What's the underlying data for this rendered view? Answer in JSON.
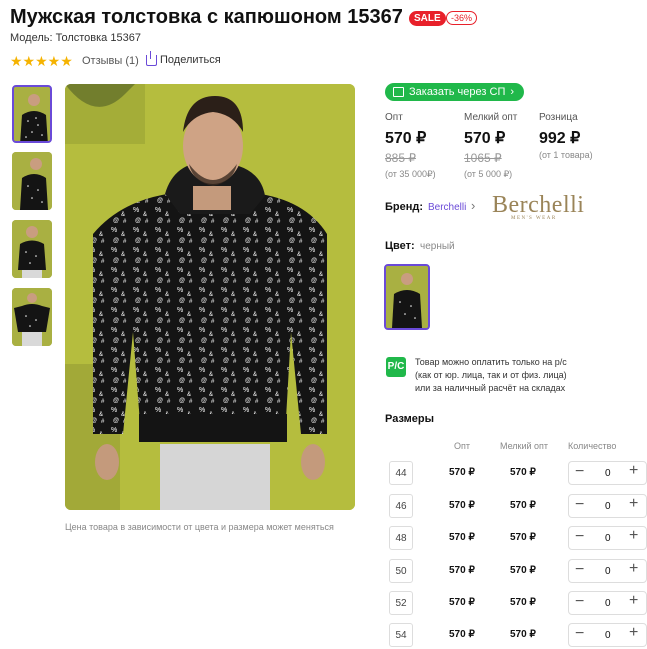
{
  "product": {
    "title": "Мужская толстовка с капюшоном 15367",
    "sale_badge": "SALE",
    "discount_badge": "-36%",
    "model": "Модель: Толстовка 15367",
    "stars": "★★★★★",
    "reviews": "Отзывы (1)",
    "share": "Поделиться"
  },
  "gallery": {
    "caption": "Цена товара в зависимости от цвета и размера может меняться",
    "thumb_count": 4,
    "background_color": "#b8bf3f"
  },
  "order": {
    "button_label": "Заказать через СП",
    "chevron": "›"
  },
  "prices": [
    {
      "label": "Опт",
      "price": "570 ₽",
      "old": "885 ₽",
      "note": "(от 35 000₽)"
    },
    {
      "label": "Мелкий опт",
      "price": "570 ₽",
      "old": "1065 ₽",
      "note": "(от 5 000 ₽)"
    },
    {
      "label": "Розница",
      "price": "992 ₽",
      "old": "",
      "note": "(от 1 товара)"
    }
  ],
  "brand": {
    "label": "Бренд:",
    "name": "Berchelli",
    "chevron": "›",
    "logo_text": "Berchelli",
    "logo_sub": "MEN'S WEAR"
  },
  "color": {
    "label": "Цвет:",
    "value": "черный"
  },
  "payment": {
    "icon_text": "P/C",
    "line1": "Товар можно оплатить только на р/с",
    "line2": "(как от юр. лица, так и от физ. лица)",
    "line3": "или за наличный расчёт на складах"
  },
  "sizes": {
    "title": "Размеры",
    "headers": {
      "opt": "Опт",
      "small_opt": "Мелкий опт",
      "qty": "Количество"
    },
    "minus": "−",
    "plus": "+",
    "rows": [
      {
        "size": "44",
        "opt": "570 ₽",
        "small_opt": "570 ₽",
        "qty": "0"
      },
      {
        "size": "46",
        "opt": "570 ₽",
        "small_opt": "570 ₽",
        "qty": "0"
      },
      {
        "size": "48",
        "opt": "570 ₽",
        "small_opt": "570 ₽",
        "qty": "0"
      },
      {
        "size": "50",
        "opt": "570 ₽",
        "small_opt": "570 ₽",
        "qty": "0"
      },
      {
        "size": "52",
        "opt": "570 ₽",
        "small_opt": "570 ₽",
        "qty": "0"
      },
      {
        "size": "54",
        "opt": "570 ₽",
        "small_opt": "570 ₽",
        "qty": "0"
      }
    ]
  },
  "colors": {
    "accent": "#6a4ad8",
    "sale": "#e8202a",
    "green": "#20b84a"
  }
}
